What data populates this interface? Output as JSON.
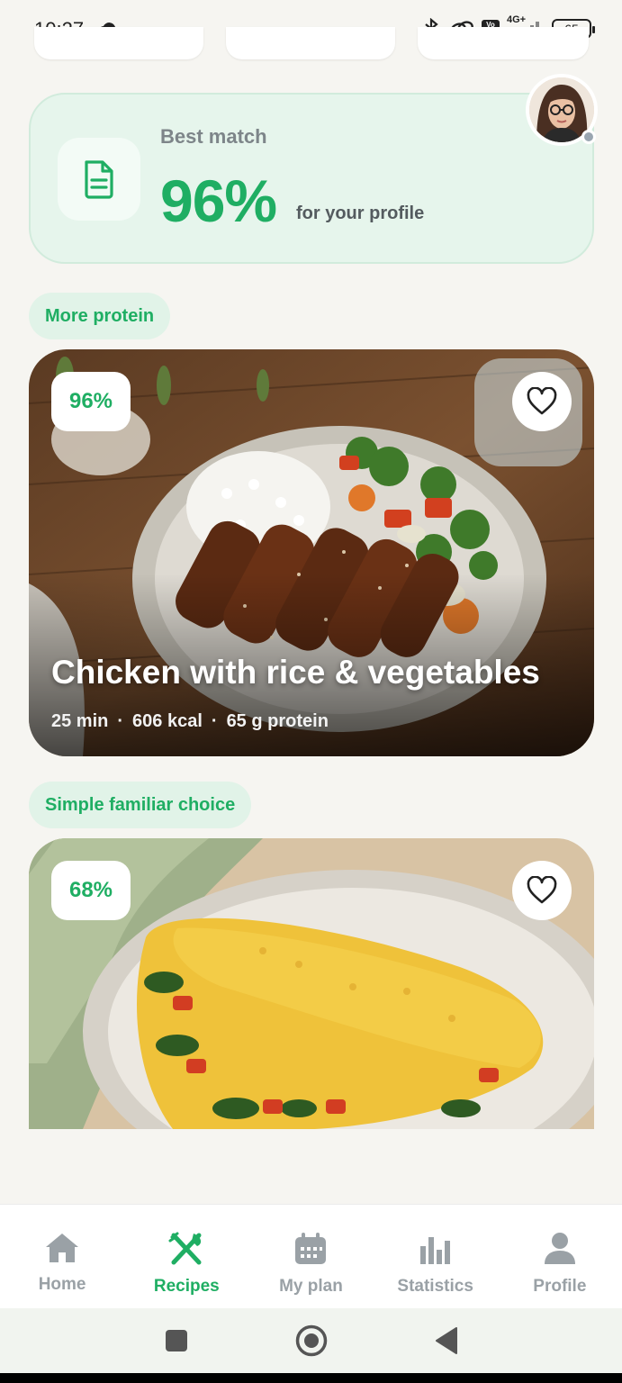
{
  "status_bar": {
    "time": "10:27",
    "dots": "···",
    "battery": "65",
    "network": "4G+",
    "volte": "Vo LTE"
  },
  "best_match": {
    "label": "Best match",
    "percent": "96%",
    "subtitle": "for your profile"
  },
  "sections": [
    {
      "chip": "More protein",
      "recipe": {
        "match": "96%",
        "title": "Chicken with rice & vegetables",
        "time": "25 min",
        "kcal": "606 kcal",
        "protein": "65 g protein",
        "separator": "·"
      }
    },
    {
      "chip": "Simple familiar choice",
      "recipe": {
        "match": "68%"
      }
    }
  ],
  "nav": [
    {
      "label": "Home",
      "icon": "home-icon",
      "active": false
    },
    {
      "label": "Recipes",
      "icon": "fork-knife-icon",
      "active": true
    },
    {
      "label": "My plan",
      "icon": "calendar-icon",
      "active": false
    },
    {
      "label": "Statistics",
      "icon": "bar-chart-icon",
      "active": false
    },
    {
      "label": "Profile",
      "icon": "person-icon",
      "active": false
    }
  ],
  "colors": {
    "accent": "#1fae63",
    "inactive": "#9aa1a6",
    "card_tint": "#e6f5ec"
  }
}
